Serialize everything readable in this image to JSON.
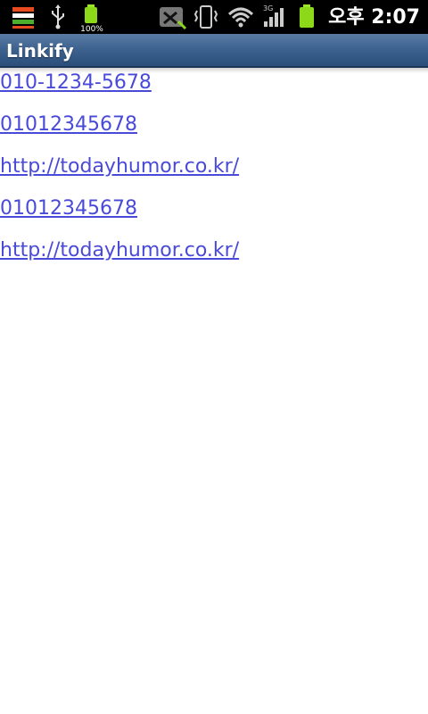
{
  "status_bar": {
    "icons": [
      "notification-icon",
      "usb-icon",
      "battery-small-icon",
      "shortcut-icon",
      "vibrate-icon",
      "wifi-icon",
      "signal-3g-icon",
      "battery-icon"
    ],
    "battery_percent_label": "100%",
    "network_label": "3G",
    "clock": "오후 2:07"
  },
  "app": {
    "title": "Linkify"
  },
  "links": [
    {
      "text": "010-1234-5678"
    },
    {
      "text": "01012345678"
    },
    {
      "text": "http://todayhumor.co.kr/"
    },
    {
      "text": "01012345678"
    },
    {
      "text": "http://todayhumor.co.kr/"
    }
  ],
  "colors": {
    "link": "#4a4ad8",
    "title_bar": "#3f6390",
    "status_bar": "#000000",
    "battery": "#8ed81a"
  }
}
